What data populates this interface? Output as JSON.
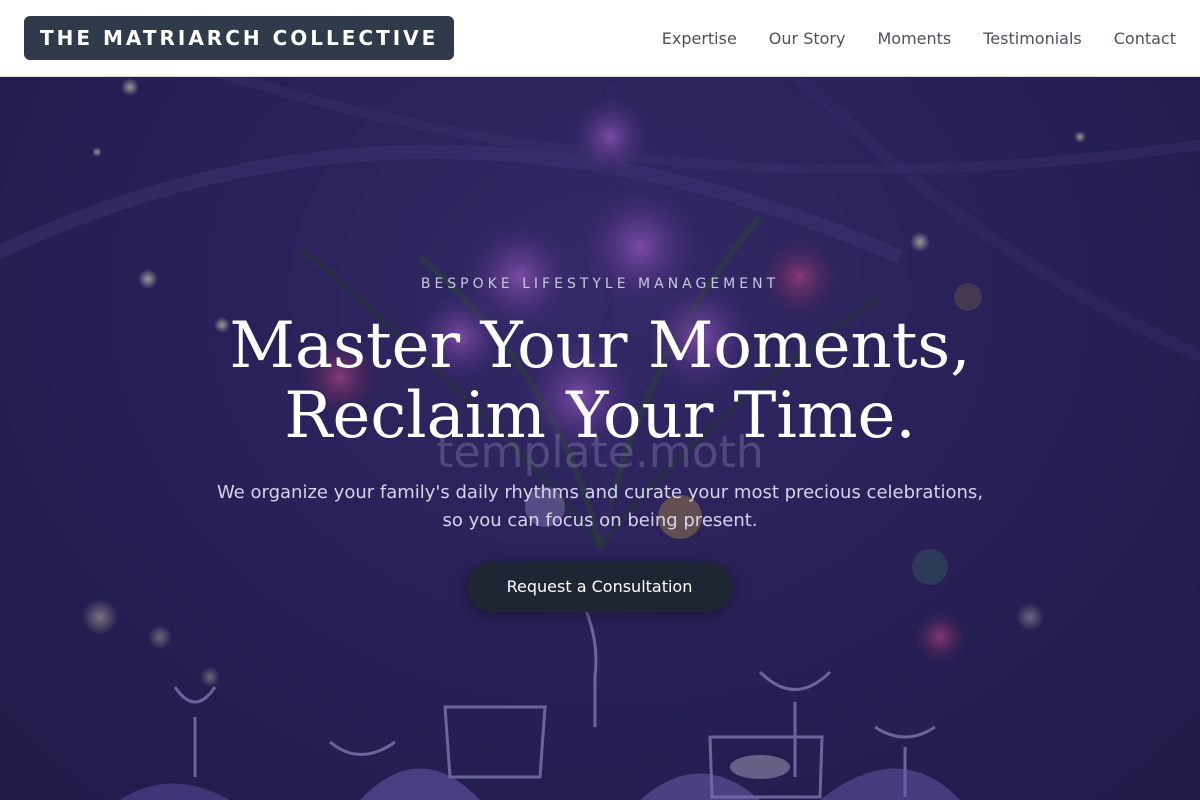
{
  "header": {
    "logo": "THE MATRIARCH COLLECTIVE",
    "nav": [
      {
        "label": "Expertise"
      },
      {
        "label": "Our Story"
      },
      {
        "label": "Moments"
      },
      {
        "label": "Testimonials"
      },
      {
        "label": "Contact"
      }
    ]
  },
  "hero": {
    "eyebrow": "BESPOKE LIFESTYLE MANAGEMENT",
    "headline_line1": "Master Your Moments,",
    "headline_line2": "Reclaim Your Time.",
    "watermark": "template.moth",
    "subtitle_line1": "We organize your family's daily rhythms and curate your most precious celebrations,",
    "subtitle_line2": "so you can focus on being present.",
    "cta_label": "Request a Consultation",
    "background_icon": "floral-centerpiece-photo"
  },
  "colors": {
    "logo_bg": "#2f3a4a",
    "nav_text": "#4a5160",
    "hero_tint": "#2a2258",
    "cta_bg": "#1f2633"
  }
}
